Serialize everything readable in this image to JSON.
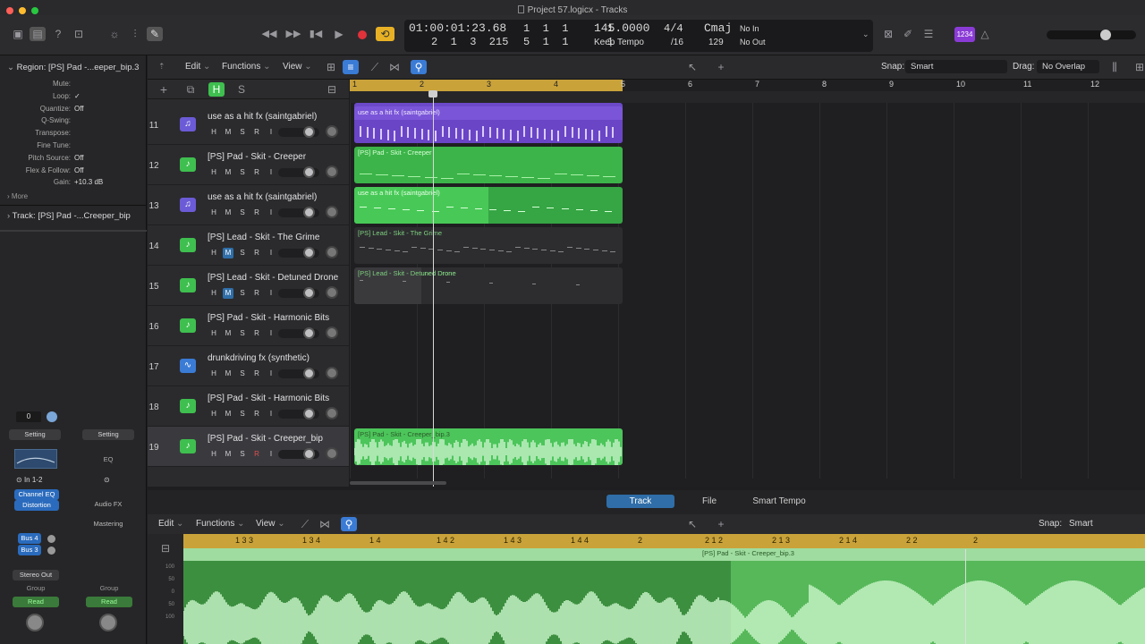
{
  "window": {
    "title": "Project 57.logicx - Tracks"
  },
  "lcd": {
    "time": "01:00:01:23.68",
    "bars_top": "1  1  1      1",
    "tempo": "145.0000",
    "sig": "4/4",
    "key": "Cmaj",
    "input": "No In",
    "bars_bottom": "2  1  3  215",
    "bars_bottom2": "5  1  1      1",
    "tempo_mode": "Keep Tempo",
    "division": "/16",
    "bpm2": "129",
    "output": "No Out"
  },
  "badge": "1234",
  "inspector": {
    "region_label": "Region:",
    "region_name": "[PS] Pad -...eeper_bip.3",
    "params": [
      {
        "k": "Mute:",
        "v": ""
      },
      {
        "k": "Loop:",
        "v": "✓"
      },
      {
        "k": "Quantize:",
        "v": "Off"
      },
      {
        "k": "Q-Swing:",
        "v": ""
      },
      {
        "k": "Transpose:",
        "v": ""
      },
      {
        "k": "Fine Tune:",
        "v": ""
      },
      {
        "k": "Pitch Source:",
        "v": "Off"
      },
      {
        "k": "Flex & Follow:",
        "v": "Off"
      },
      {
        "k": "Gain:",
        "v": "+10.3 dB"
      }
    ],
    "more": "More",
    "track_label": "Track:",
    "track_name": "[PS] Pad -...Creeper_bip",
    "strip1": {
      "value": "0",
      "setting": "Setting",
      "channel_eq": "Channel EQ",
      "distortion": "Distortion",
      "io": "In 1-2",
      "bus4": "Bus 4",
      "bus3": "Bus 3",
      "out": "Stereo Out",
      "group": "Group",
      "read": "Read"
    },
    "strip2": {
      "setting": "Setting",
      "eq": "EQ",
      "audio_fx": "Audio FX",
      "mastering": "Mastering",
      "group": "Group",
      "read": "Read"
    }
  },
  "toolbar": {
    "edit": "Edit",
    "functions": "Functions",
    "view": "View",
    "snap_label": "Snap:",
    "snap": "Smart",
    "drag_label": "Drag:",
    "drag": "No Overlap",
    "h_btn": "H",
    "s_btn": "S"
  },
  "hm": {
    "h": "H",
    "m": "M",
    "s": "S",
    "r": "R",
    "i": "I"
  },
  "ruler": [
    "1",
    "2",
    "3",
    "4",
    "5",
    "6",
    "7",
    "8",
    "9",
    "10",
    "11",
    "12"
  ],
  "tracks": [
    {
      "num": "11",
      "name": "use as a hit fx (saintgabriel)",
      "type": "synth"
    },
    {
      "num": "12",
      "name": "[PS] Pad - Skit - Creeper",
      "type": "midi"
    },
    {
      "num": "13",
      "name": "use as a hit fx (saintgabriel)",
      "type": "synth"
    },
    {
      "num": "14",
      "name": "[PS] Lead - Skit - The Grime",
      "type": "midi"
    },
    {
      "num": "15",
      "name": "[PS] Lead - Skit - Detuned Drone",
      "type": "midi"
    },
    {
      "num": "16",
      "name": "[PS] Pad - Skit - Harmonic Bits",
      "type": "midi"
    },
    {
      "num": "17",
      "name": "drunkdriving fx (synthetic)",
      "type": "audio"
    },
    {
      "num": "18",
      "name": "[PS] Pad - Skit - Harmonic Bits",
      "type": "midi"
    },
    {
      "num": "19",
      "name": "[PS] Pad - Skit - Creeper_bip",
      "type": "midi"
    }
  ],
  "regions": [
    "use as a hit fx (saintgabriel)",
    "[PS] Pad - Skit - Creeper",
    "use as a hit fx (saintgabriel)",
    "[PS] Lead - Skit - The Grime",
    "[PS] Lead - Skit - Detuned Drone",
    "[PS] Pad - Skit - Creeper_bip.3"
  ],
  "editor": {
    "tabs": [
      "Track",
      "File",
      "Smart Tempo"
    ],
    "edit": "Edit",
    "functions": "Functions",
    "view": "View",
    "snap_label": "Snap:",
    "snap": "Smart",
    "ruler": [
      "1 3 3",
      "1 3 4",
      "1 4",
      "1 4 2",
      "1 4 3",
      "1 4 4",
      "2",
      "2 1 2",
      "2 1 3",
      "2 1 4",
      "2 2",
      "2"
    ],
    "region": "[PS] Pad - Skit - Creeper_bip.3",
    "y_ticks": [
      "100",
      "50",
      "0",
      "50",
      "100"
    ]
  }
}
